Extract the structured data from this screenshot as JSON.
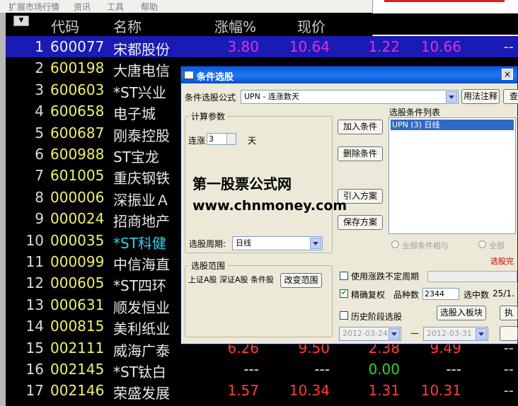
{
  "menu": [
    "扩展市场行情",
    "资讯",
    "工具",
    "帮助"
  ],
  "header": {
    "arrow": "▼",
    "code": "代码",
    "name": "名称",
    "pct": "涨幅%",
    "price": "现价"
  },
  "colors": {
    "red": "#ff3c3c",
    "green": "#28d828",
    "magenta": "#e030e0",
    "yellow": "#f0f070",
    "cyan": "#30d0f0",
    "white": "#e8e8e8"
  },
  "rows": [
    {
      "no": "1",
      "code": "600077",
      "name": "宋都股份",
      "pct": "3.80",
      "price": "10.64",
      "c4": "1.22",
      "c5": "10.66",
      "c6": "--"
    },
    {
      "no": "2",
      "code": "600198",
      "name": "大唐电信"
    },
    {
      "no": "3",
      "code": "600603",
      "name": "*ST兴业"
    },
    {
      "no": "4",
      "code": "600658",
      "name": "电子城"
    },
    {
      "no": "5",
      "code": "600687",
      "name": "刚泰控股"
    },
    {
      "no": "6",
      "code": "600988",
      "name": "ST宝龙"
    },
    {
      "no": "7",
      "code": "601005",
      "name": "重庆钢铁"
    },
    {
      "no": "8",
      "code": "000006",
      "name": "深振业Ａ"
    },
    {
      "no": "9",
      "code": "000024",
      "name": "招商地产"
    },
    {
      "no": "10",
      "code": "000035",
      "name": "*ST科健"
    },
    {
      "no": "11",
      "code": "000099",
      "name": "中信海直"
    },
    {
      "no": "12",
      "code": "000605",
      "name": "*ST四环"
    },
    {
      "no": "13",
      "code": "000631",
      "name": "顺发恒业"
    },
    {
      "no": "14",
      "code": "000815",
      "name": "美利纸业"
    },
    {
      "no": "15",
      "code": "002111",
      "name": "威海广泰",
      "pct": "6.26",
      "price": "9.50",
      "c4": "2.38",
      "c5": "9.49",
      "c6": "--"
    },
    {
      "no": "16",
      "code": "002145",
      "name": "*ST钛白",
      "pct": "---",
      "price": "---",
      "c4": "0.00",
      "c5": "---",
      "c6": "--"
    },
    {
      "no": "17",
      "code": "002146",
      "name": "荣盛发展",
      "pct": "1.57",
      "price": "10.34",
      "c4": "1.31",
      "c5": "10.31",
      "c6": "--"
    }
  ],
  "dialog": {
    "title": "条件选股",
    "close": "×",
    "formula_label": "条件选股公式",
    "formula_value": "UPN     - 连涨数天",
    "usage_button": "用法注释",
    "view_button": "查",
    "params_group": "计算参数",
    "param_label": "连涨",
    "param_value": "3",
    "param_unit": "天",
    "add_button": "加入条件",
    "delete_button": "删除条件",
    "import_button": "引入方案",
    "save_button": "保存方案",
    "cond_list_label": "选股条件列表",
    "cond_items": [
      "UPN (3) 日线"
    ],
    "period_label": "选股周期:",
    "period_value": "日线",
    "all_and": "全部条件相与",
    "all_or": "全部",
    "status": "选股完",
    "range_group": "选股范围",
    "range_text": "上证A股 深证A股 条件股",
    "change_range_button": "改变范围",
    "use_period_label": "使用涨跌不定周期",
    "exact_label": "精确复权",
    "exact_checked": "✔",
    "count_label": "品种数",
    "count_value": "2344",
    "selected_label": "选中数",
    "selected_value": "25/1.",
    "history_label": "历史阶段选股",
    "to_block_button": "选股入板块",
    "exec_button": "执",
    "date_from": "2012-03-24",
    "date_sep": "—",
    "date_to": "2012-03-31"
  },
  "watermark": {
    "line1": "第一股票公式网",
    "line2": "www.chnmoney.com"
  }
}
